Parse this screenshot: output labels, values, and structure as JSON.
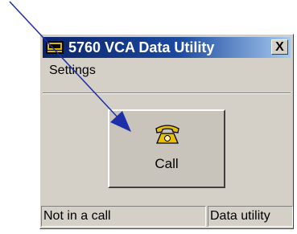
{
  "window": {
    "title": "5760 VCA Data Utility",
    "close_label": "X"
  },
  "menu": {
    "items": [
      {
        "label": "Settings"
      }
    ]
  },
  "call_button": {
    "label": "Call"
  },
  "status_bar": {
    "left": "Not in a call",
    "right": "Data utility"
  },
  "icons": {
    "app": "terminal-icon",
    "call": "telephone-icon",
    "pointer": "arrow-pointer"
  },
  "colors": {
    "titlebar": "#0a246a",
    "window_bg": "#d4d0c8",
    "phone": "#e8c000",
    "arrow": "#1c2fa8"
  }
}
